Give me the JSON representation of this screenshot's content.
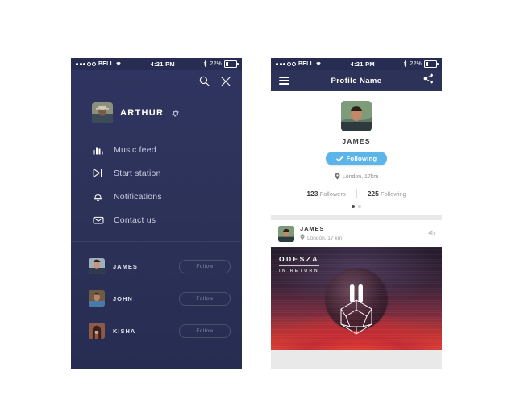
{
  "status_bar": {
    "signal_dots_filled": 3,
    "signal_dots_hollow": 2,
    "carrier": "BELL",
    "wifi_icon": "wifi-icon",
    "time": "4:21 PM",
    "bluetooth_icon": "bluetooth-icon",
    "battery_percent": "22%",
    "battery_icon": "battery-icon"
  },
  "left_phone": {
    "top_icons": [
      {
        "name": "search-icon",
        "label": "Search"
      },
      {
        "name": "close-icon",
        "label": "Close"
      }
    ],
    "account": {
      "name": "ARTHUR",
      "avatar_name": "avatar-arthur",
      "settings_icon": "gear-icon"
    },
    "menu": [
      {
        "label": "Music feed",
        "icon": "bar-chart-icon"
      },
      {
        "label": "Start station",
        "icon": "play-skip-icon"
      },
      {
        "label": "Notifications",
        "icon": "bell-icon"
      },
      {
        "label": "Contact us",
        "icon": "envelope-icon"
      }
    ],
    "friends": [
      {
        "name": "JAMES",
        "action": "Follow",
        "avatar_name": "avatar-james"
      },
      {
        "name": "JOHN",
        "action": "Follow",
        "avatar_name": "avatar-john"
      },
      {
        "name": "KISHA",
        "action": "Follow",
        "avatar_name": "avatar-kisha"
      }
    ]
  },
  "right_phone": {
    "navbar": {
      "menu_icon": "hamburger-icon",
      "title": "Profile Name",
      "share_icon": "share-icon"
    },
    "profile": {
      "avatar_name": "avatar-profile-james",
      "name": "JAMES",
      "follow_state_label": "Following",
      "follow_check_icon": "check-icon",
      "location_icon": "location-pin-icon",
      "location": "London, 17km",
      "followers_count": "123",
      "followers_label": "Followers",
      "following_count": "225",
      "following_label": "Following",
      "page_dots": 2,
      "page_dot_active_index": 0
    },
    "post": {
      "avatar_name": "avatar-post-james",
      "author": "JAMES",
      "location_icon": "location-pin-icon",
      "location": "London, 17 km",
      "time_ago": "4h",
      "artwork": {
        "artist": "ODESZA",
        "album": "IN RETURN",
        "logo_icon": "odesza-icosahedron-logo-icon"
      }
    }
  },
  "colors": {
    "navy": "#2c3258",
    "navy_dark": "#262c52",
    "accent_blue": "#5bb5e8",
    "canvas": "#ffffff",
    "card": "#ffffff",
    "card_gap": "#e9e9e9"
  }
}
